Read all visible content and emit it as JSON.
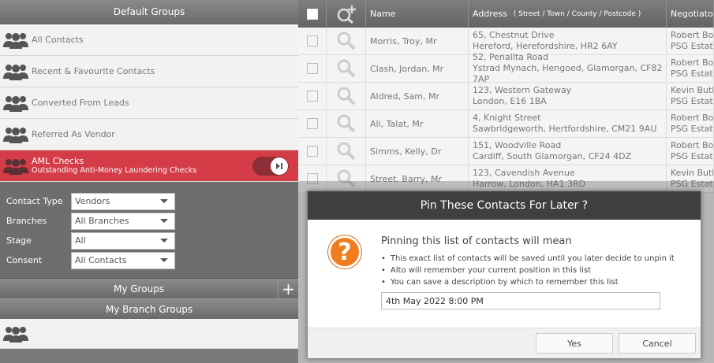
{
  "sidebar": {
    "header": "Default Groups",
    "groups": [
      {
        "label": "All Contacts"
      },
      {
        "label": "Recent & Favourite Contacts"
      },
      {
        "label": "Converted From Leads"
      },
      {
        "label": "Referred As Vendor"
      }
    ],
    "active_group": {
      "title": "AML Checks",
      "subtitle": "Outstanding Anti-Money Laundering Checks"
    },
    "filters": [
      {
        "label": "Contact Type",
        "value": "Vendors"
      },
      {
        "label": "Branches",
        "value": "All Branches"
      },
      {
        "label": "Stage",
        "value": "All"
      },
      {
        "label": "Consent",
        "value": "All Contacts"
      }
    ],
    "my_groups": "My Groups",
    "add_symbol": "+",
    "branch_groups": "My Branch Groups"
  },
  "table": {
    "headers": {
      "name": "Name",
      "address": "Address",
      "address_sub": "( Street /  Town /  County /  Postcode )",
      "negotiator": "Negotiator"
    },
    "rows": [
      {
        "name": "Morris, Troy, Mr",
        "addr1": "65, Chestnut Drive",
        "addr2": "Hereford, Herefordshire, HR2 6AY",
        "neg1": "Robert Bohe",
        "neg2": "PSG Estates"
      },
      {
        "name": "Clash, Jordan, Mr",
        "addr1": "52, Penallta Road",
        "addr2": "Ystrad Mynach, Hengoed, Glamorgan, CF82 7AP",
        "neg1": "Robert Bohe",
        "neg2": "PSG Estates"
      },
      {
        "name": "Aldred, Sam, Mr",
        "addr1": "123, Western Gateway",
        "addr2": "London, E16 1BA",
        "neg1": "Kevin Butler",
        "neg2": "PSG Estates"
      },
      {
        "name": "Ali, Talat, Mr",
        "addr1": "4, Knight Street",
        "addr2": "Sawbridgeworth, Hertfordshire, CM21 9AU",
        "neg1": "Robert Bohe",
        "neg2": "PSG Estates"
      },
      {
        "name": "Simms, Kelly, Dr",
        "addr1": "151, Woodville Road",
        "addr2": "Cardiff, South Glamorgan, CF24 4DZ",
        "neg1": "Robert Bohe",
        "neg2": "PSG Estates"
      },
      {
        "name": "Street, Barry, Mr",
        "addr1": "123, Cavendish Avenue",
        "addr2": "Harrow, London, HA1 3RD",
        "neg1": "Kevin Butler",
        "neg2": "PSG Estates"
      }
    ]
  },
  "modal": {
    "title": "Pin These Contacts For Later ?",
    "icon_glyph": "?",
    "heading": "Pinning this list of contacts will mean",
    "bullets": [
      "This exact list of contacts will be saved until you later decide to unpin it",
      "Alto will remember your current position in this list",
      "You can save a description by which to remember this list"
    ],
    "description_value": "4th May 2022 8:00 PM",
    "yes_label": "Yes",
    "cancel_label": "Cancel"
  },
  "colors": {
    "active_group": "#d43c48",
    "modal_icon": "#f07c1e",
    "modal_title_bar": "#3f3f3f"
  }
}
